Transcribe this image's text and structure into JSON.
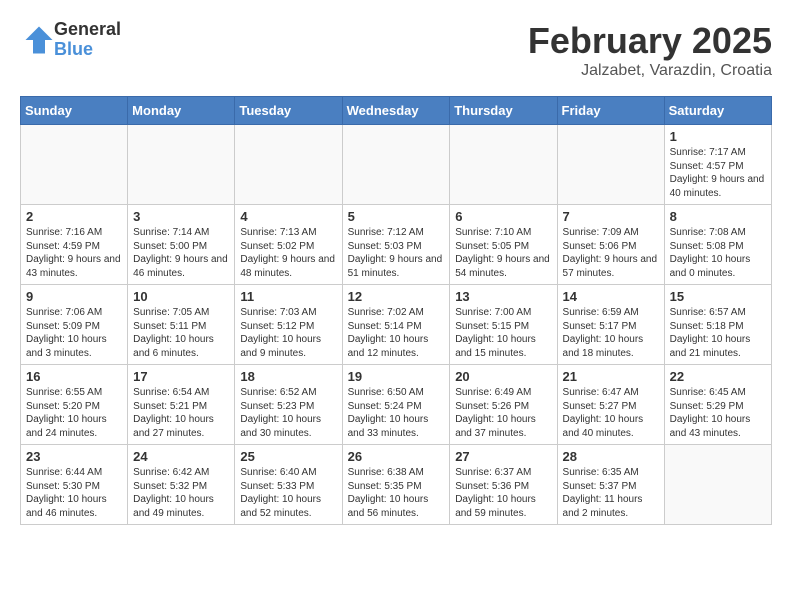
{
  "header": {
    "logo_general": "General",
    "logo_blue": "Blue",
    "month": "February 2025",
    "location": "Jalzabet, Varazdin, Croatia"
  },
  "weekdays": [
    "Sunday",
    "Monday",
    "Tuesday",
    "Wednesday",
    "Thursday",
    "Friday",
    "Saturday"
  ],
  "weeks": [
    [
      {
        "day": "",
        "info": ""
      },
      {
        "day": "",
        "info": ""
      },
      {
        "day": "",
        "info": ""
      },
      {
        "day": "",
        "info": ""
      },
      {
        "day": "",
        "info": ""
      },
      {
        "day": "",
        "info": ""
      },
      {
        "day": "1",
        "info": "Sunrise: 7:17 AM\nSunset: 4:57 PM\nDaylight: 9 hours and 40 minutes."
      }
    ],
    [
      {
        "day": "2",
        "info": "Sunrise: 7:16 AM\nSunset: 4:59 PM\nDaylight: 9 hours and 43 minutes."
      },
      {
        "day": "3",
        "info": "Sunrise: 7:14 AM\nSunset: 5:00 PM\nDaylight: 9 hours and 46 minutes."
      },
      {
        "day": "4",
        "info": "Sunrise: 7:13 AM\nSunset: 5:02 PM\nDaylight: 9 hours and 48 minutes."
      },
      {
        "day": "5",
        "info": "Sunrise: 7:12 AM\nSunset: 5:03 PM\nDaylight: 9 hours and 51 minutes."
      },
      {
        "day": "6",
        "info": "Sunrise: 7:10 AM\nSunset: 5:05 PM\nDaylight: 9 hours and 54 minutes."
      },
      {
        "day": "7",
        "info": "Sunrise: 7:09 AM\nSunset: 5:06 PM\nDaylight: 9 hours and 57 minutes."
      },
      {
        "day": "8",
        "info": "Sunrise: 7:08 AM\nSunset: 5:08 PM\nDaylight: 10 hours and 0 minutes."
      }
    ],
    [
      {
        "day": "9",
        "info": "Sunrise: 7:06 AM\nSunset: 5:09 PM\nDaylight: 10 hours and 3 minutes."
      },
      {
        "day": "10",
        "info": "Sunrise: 7:05 AM\nSunset: 5:11 PM\nDaylight: 10 hours and 6 minutes."
      },
      {
        "day": "11",
        "info": "Sunrise: 7:03 AM\nSunset: 5:12 PM\nDaylight: 10 hours and 9 minutes."
      },
      {
        "day": "12",
        "info": "Sunrise: 7:02 AM\nSunset: 5:14 PM\nDaylight: 10 hours and 12 minutes."
      },
      {
        "day": "13",
        "info": "Sunrise: 7:00 AM\nSunset: 5:15 PM\nDaylight: 10 hours and 15 minutes."
      },
      {
        "day": "14",
        "info": "Sunrise: 6:59 AM\nSunset: 5:17 PM\nDaylight: 10 hours and 18 minutes."
      },
      {
        "day": "15",
        "info": "Sunrise: 6:57 AM\nSunset: 5:18 PM\nDaylight: 10 hours and 21 minutes."
      }
    ],
    [
      {
        "day": "16",
        "info": "Sunrise: 6:55 AM\nSunset: 5:20 PM\nDaylight: 10 hours and 24 minutes."
      },
      {
        "day": "17",
        "info": "Sunrise: 6:54 AM\nSunset: 5:21 PM\nDaylight: 10 hours and 27 minutes."
      },
      {
        "day": "18",
        "info": "Sunrise: 6:52 AM\nSunset: 5:23 PM\nDaylight: 10 hours and 30 minutes."
      },
      {
        "day": "19",
        "info": "Sunrise: 6:50 AM\nSunset: 5:24 PM\nDaylight: 10 hours and 33 minutes."
      },
      {
        "day": "20",
        "info": "Sunrise: 6:49 AM\nSunset: 5:26 PM\nDaylight: 10 hours and 37 minutes."
      },
      {
        "day": "21",
        "info": "Sunrise: 6:47 AM\nSunset: 5:27 PM\nDaylight: 10 hours and 40 minutes."
      },
      {
        "day": "22",
        "info": "Sunrise: 6:45 AM\nSunset: 5:29 PM\nDaylight: 10 hours and 43 minutes."
      }
    ],
    [
      {
        "day": "23",
        "info": "Sunrise: 6:44 AM\nSunset: 5:30 PM\nDaylight: 10 hours and 46 minutes."
      },
      {
        "day": "24",
        "info": "Sunrise: 6:42 AM\nSunset: 5:32 PM\nDaylight: 10 hours and 49 minutes."
      },
      {
        "day": "25",
        "info": "Sunrise: 6:40 AM\nSunset: 5:33 PM\nDaylight: 10 hours and 52 minutes."
      },
      {
        "day": "26",
        "info": "Sunrise: 6:38 AM\nSunset: 5:35 PM\nDaylight: 10 hours and 56 minutes."
      },
      {
        "day": "27",
        "info": "Sunrise: 6:37 AM\nSunset: 5:36 PM\nDaylight: 10 hours and 59 minutes."
      },
      {
        "day": "28",
        "info": "Sunrise: 6:35 AM\nSunset: 5:37 PM\nDaylight: 11 hours and 2 minutes."
      },
      {
        "day": "",
        "info": ""
      }
    ]
  ]
}
